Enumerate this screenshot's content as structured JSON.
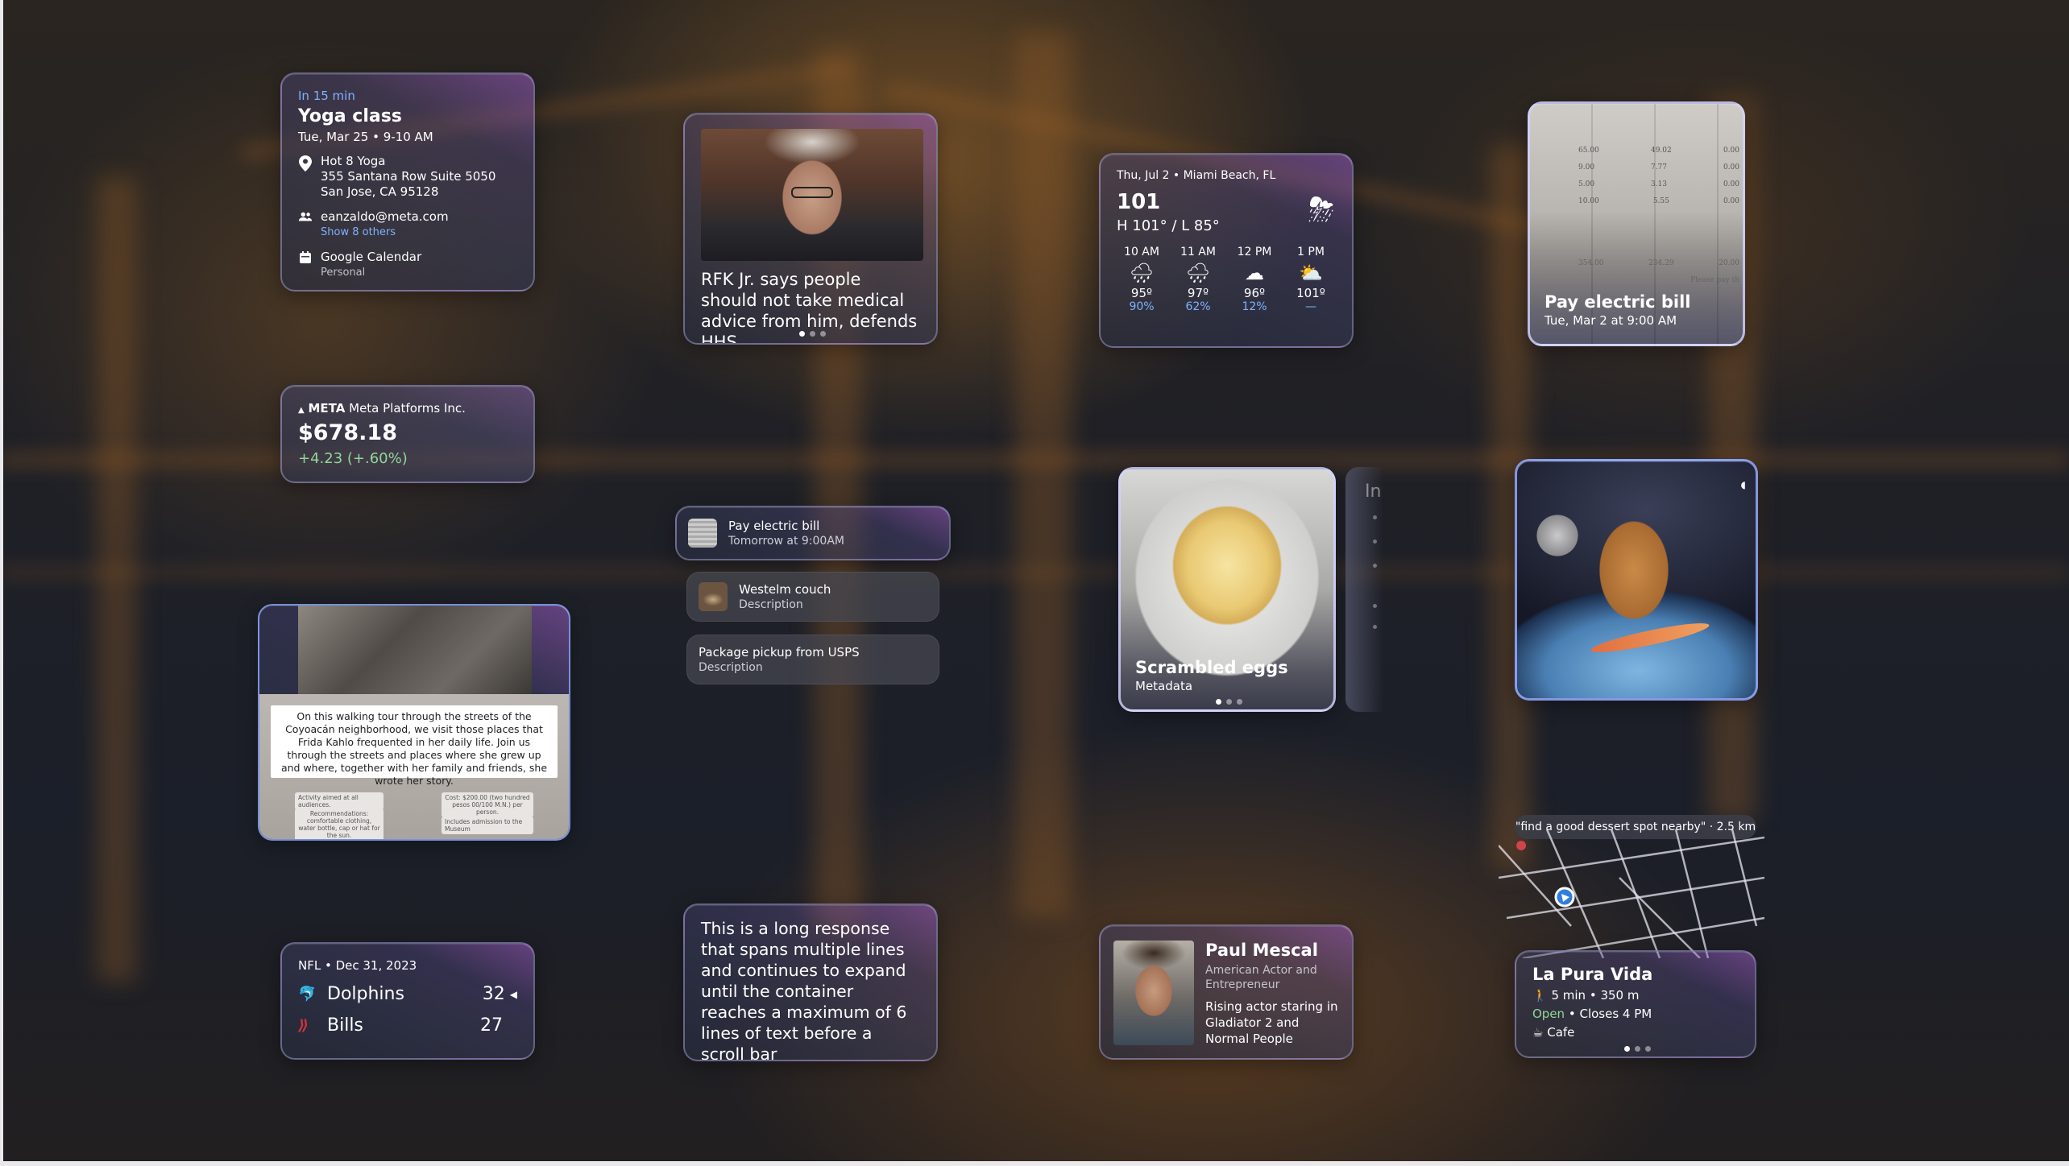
{
  "calendar": {
    "when": "In 15 min",
    "title": "Yoga class",
    "date": "Tue, Mar 25 • 9-10 AM",
    "location_name": "Hot 8 Yoga",
    "address_line1": "355 Santana Row Suite 5050",
    "address_line2": "San Jose, CA 95128",
    "attendee": "eanzaldo@meta.com",
    "show_others": "Show 8 others",
    "calendar_name": "Google Calendar",
    "calendar_type": "Personal"
  },
  "stock": {
    "ticker": "META",
    "company": "Meta Platforms Inc.",
    "price": "$678.18",
    "change": "+4.23 (+.60%)",
    "change_color": "#8fd79a"
  },
  "frida": {
    "text": "On this walking tour through the streets of the Coyoacán neighborhood, we visit those places that Frida Kahlo frequented in her daily life. Join us through the streets and places where she grew up and where, together with her family and friends, she wrote her story.",
    "tag1": "Activity aimed at all audiences.",
    "tag2": "Recommendations: comfortable clothing, water bottle, cap or hat for the sun.",
    "tag3": "Cost: $200.00 (two hundred pesos 00/100 M.N.) per person.",
    "tag4": "Includes admission to the Museum"
  },
  "nfl": {
    "header": "NFL • Dec 31, 2023",
    "teams": [
      {
        "name": "Dolphins",
        "score": "32",
        "logo_icon": "dolphins-logo-icon",
        "possession": true
      },
      {
        "name": "Bills",
        "score": "27",
        "logo_icon": "bills-logo-icon",
        "possession": false
      }
    ]
  },
  "news": {
    "headline": "RFK Jr. says people should not take medical advice from him, defends HHS..."
  },
  "reminders": [
    {
      "title": "Pay electric bill",
      "subtitle": "Tomorrow at 9:00AM"
    },
    {
      "title": "Westelm couch",
      "subtitle": "Description"
    },
    {
      "title": "Package pickup from USPS",
      "subtitle": "Description"
    }
  ],
  "response": {
    "text": "This is a long response that spans multiple lines and continues to expand until the container reaches a maximum of 6 lines of text before a scroll bar"
  },
  "weather": {
    "header": "Thu, Jul 2 • Miami Beach, FL",
    "current": "101",
    "high_low": "H 101° / L 85°",
    "icon": "thunderstorm-icon",
    "hours": [
      {
        "time": "10 AM",
        "icon": "rain-icon",
        "temp": "95º",
        "precip": "90%"
      },
      {
        "time": "11 AM",
        "icon": "rain-icon",
        "temp": "97º",
        "precip": "62%"
      },
      {
        "time": "12 PM",
        "icon": "cloud-icon",
        "temp": "96º",
        "precip": "12%"
      },
      {
        "time": "1 PM",
        "icon": "partly-sunny-icon",
        "temp": "101º",
        "precip": "—"
      }
    ]
  },
  "person": {
    "name": "Paul Mescal",
    "role": "American Actor and Entrepreneur",
    "description": "Rising actor staring in Gladiator 2 and Normal People"
  },
  "food": {
    "title": "Scrambled eggs",
    "metadata": "Metadata",
    "ghost_label": "In"
  },
  "bill": {
    "title": "Pay electric bill",
    "date": "Tue, Mar 2 at 9:00 AM",
    "rows": [
      [
        "65.00",
        "49.02",
        "0.00"
      ],
      [
        "9.00",
        "7.77",
        "0.00"
      ],
      [
        "5.00",
        "3.13",
        "0.00"
      ],
      [
        "10.00",
        "5.55",
        "0.00"
      ]
    ],
    "totals": [
      "354.00",
      "234.29",
      "20.00"
    ],
    "note": "Please pay th"
  },
  "map": {
    "query": "\"find a good dessert spot nearby\" · 2.5 km",
    "place": "La Pura Vida",
    "distance": "5 min • 350 m",
    "open": "Open",
    "hours": "• Closes 4 PM",
    "category": "Cafe"
  }
}
